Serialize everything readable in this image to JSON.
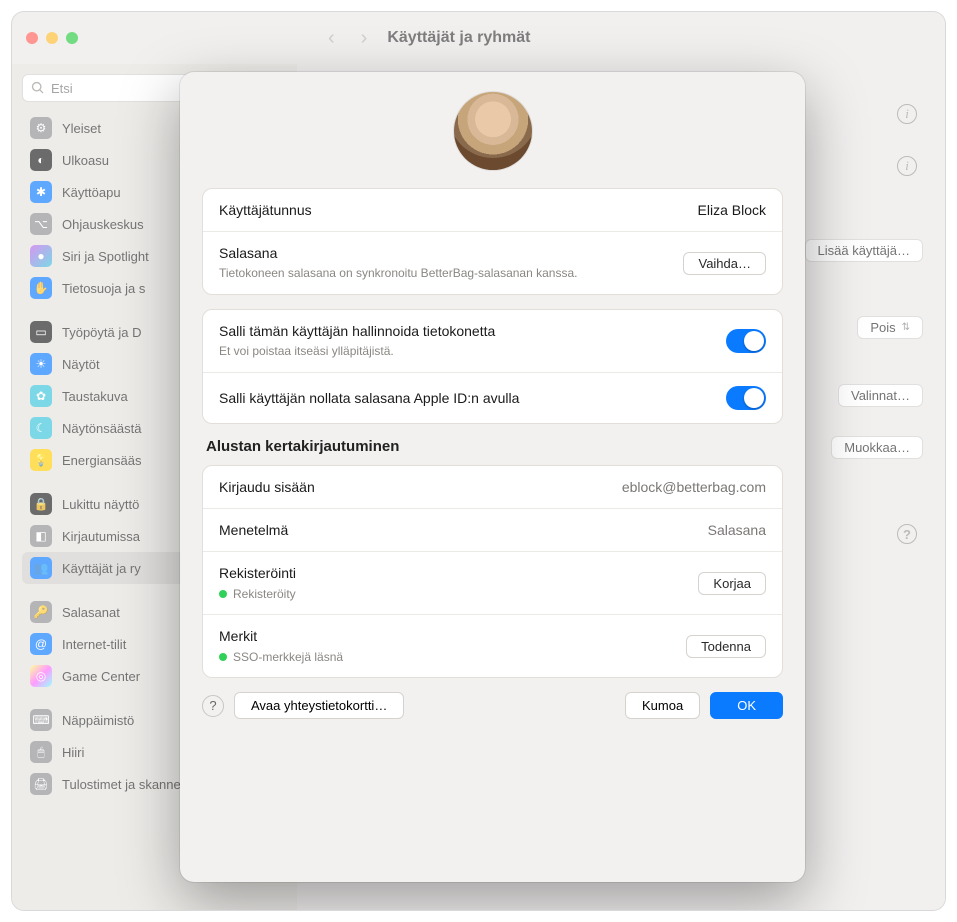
{
  "header": {
    "title": "Käyttäjät ja ryhmät"
  },
  "search": {
    "placeholder": "Etsi"
  },
  "sidebar": {
    "items": [
      {
        "label": "Yleiset",
        "iconColor": "#8e8e93"
      },
      {
        "label": "Ulkoasu",
        "iconColor": "#1c1c1e"
      },
      {
        "label": "Käyttöapu",
        "iconColor": "#0a7aff"
      },
      {
        "label": "Ohjauskeskus",
        "iconColor": "#8e8e93"
      },
      {
        "label": "Siri ja Spotlight",
        "iconColor": "#c060e8"
      },
      {
        "label": "Tietosuoja ja s",
        "iconColor": "#0a7aff"
      },
      {
        "label": "Työpöytä ja D",
        "iconColor": "#1c1c1e"
      },
      {
        "label": "Näytöt",
        "iconColor": "#0a7aff"
      },
      {
        "label": "Taustakuva",
        "iconColor": "#36c3d9"
      },
      {
        "label": "Näytönsäästä",
        "iconColor": "#36c3d9"
      },
      {
        "label": "Energiansääs",
        "iconColor": "#ffcc00"
      },
      {
        "label": "Lukittu näyttö",
        "iconColor": "#1c1c1e"
      },
      {
        "label": "Kirjautumissa",
        "iconColor": "#8e8e93"
      },
      {
        "label": "Käyttäjät ja ry",
        "iconColor": "#0a7aff"
      },
      {
        "label": "Salasanat",
        "iconColor": "#8e8e93"
      },
      {
        "label": "Internet-tilit",
        "iconColor": "#0a7aff"
      },
      {
        "label": "Game Center",
        "iconColor": "#ffffff"
      },
      {
        "label": "Näppäimistö",
        "iconColor": "#8e8e93"
      },
      {
        "label": "Hiiri",
        "iconColor": "#8e8e93"
      },
      {
        "label": "Tulostimet ja skannerit",
        "iconColor": "#8e8e93"
      }
    ]
  },
  "contentButtons": {
    "addUser": "Lisää käyttäjä…",
    "off": "Pois",
    "options": "Valinnat…",
    "edit": "Muokkaa…"
  },
  "dialog": {
    "username": {
      "label": "Käyttäjätunnus",
      "value": "Eliza Block"
    },
    "password": {
      "label": "Salasana",
      "sub": "Tietokoneen salasana on synkronoitu BetterBag-salasanan kanssa.",
      "button": "Vaihda…"
    },
    "admin": {
      "label": "Salli tämän käyttäjän hallinnoida tietokonetta",
      "sub": "Et voi poistaa itseäsi ylläpitäjistä."
    },
    "appleid": {
      "label": "Salli käyttäjän nollata salasana Apple ID:n avulla"
    },
    "sso": {
      "heading": "Alustan kertakirjautuminen",
      "signin": {
        "label": "Kirjaudu sisään",
        "value": "eblock@betterbag.com"
      },
      "method": {
        "label": "Menetelmä",
        "value": "Salasana"
      },
      "registration": {
        "label": "Rekisteröinti",
        "status": "Rekisteröity",
        "button": "Korjaa"
      },
      "tokens": {
        "label": "Merkit",
        "status": "SSO-merkkejä läsnä",
        "button": "Todenna"
      }
    },
    "footer": {
      "contact": "Avaa yhteystietokortti…",
      "cancel": "Kumoa",
      "ok": "OK"
    }
  }
}
